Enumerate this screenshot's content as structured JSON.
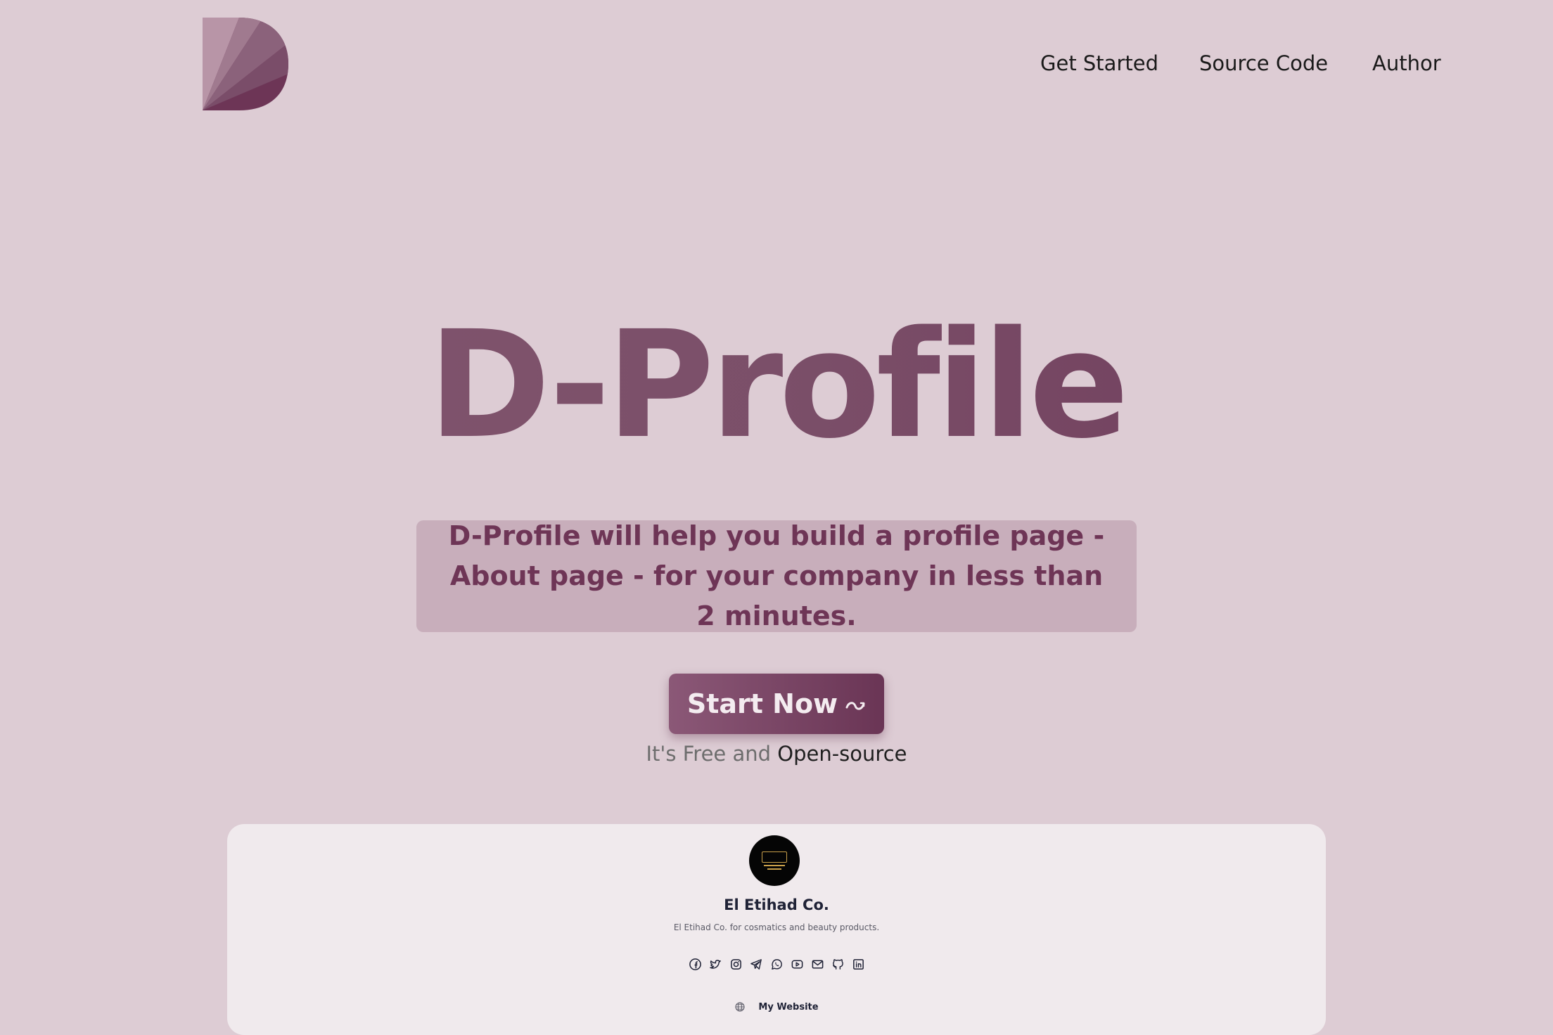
{
  "nav": {
    "get_started": "Get Started",
    "source_code": "Source Code",
    "author": "Author"
  },
  "hero": {
    "title": "D-Profile",
    "tagline": "D-Profile will help you build a profile page - About page - for your company in less than 2 minutes.",
    "cta_label": "Start Now",
    "cta_icon": "swirl-arrow-icon",
    "free_prefix": "It's Free and",
    "open_source_label": "Open-source"
  },
  "preview": {
    "company_name": "El Etihad Co.",
    "company_description": "El Etihad Co. for cosmatics and beauty products.",
    "social_icons": [
      "facebook-icon",
      "twitter-icon",
      "instagram-icon",
      "telegram-icon",
      "whatsapp-icon",
      "youtube-icon",
      "mail-icon",
      "github-icon",
      "linkedin-icon"
    ],
    "website_label": "My Website",
    "website_icon": "globe-icon"
  },
  "colors": {
    "background": "#ddccd4",
    "accent": "#6e3556",
    "tagline_box": "#c8aebb",
    "card": "#f0eaed"
  }
}
